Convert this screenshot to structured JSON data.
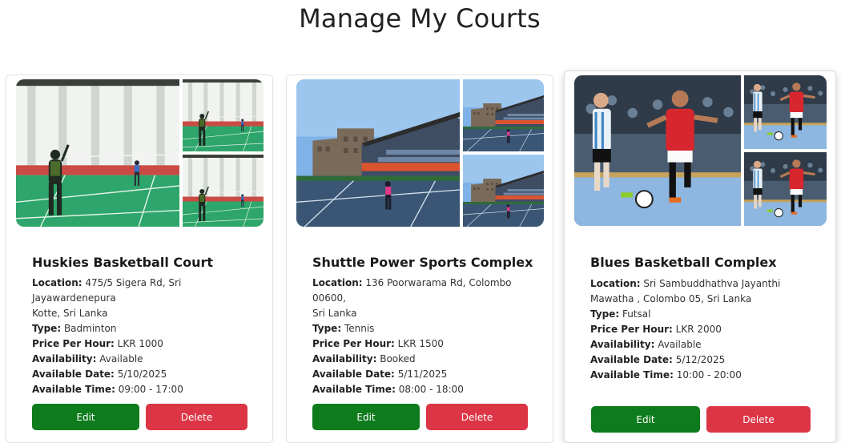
{
  "page": {
    "title": "Manage My Courts"
  },
  "labels": {
    "location": "Location:",
    "type": "Type:",
    "price": "Price Per Hour:",
    "availability": "Availability:",
    "date": "Available Date:",
    "time": "Available Time:"
  },
  "colors": {
    "edit": "#0e7b1c",
    "delete": "#dc3545"
  },
  "courts": [
    {
      "name": "Huskies Basketball Court",
      "location_line1": "475/5 Sigera Rd, Sri Jayawardenepura",
      "location_line2": "Kotte, Sri Lanka",
      "type": "Badminton",
      "price": "LKR 1000",
      "availability": "Available",
      "date": "5/10/2025",
      "time": "09:00 - 17:00",
      "edit_label": "Edit",
      "delete_label": "Delete"
    },
    {
      "name": "Shuttle Power Sports Complex",
      "location_line1": "136 Poorwarama Rd, Colombo 00600,",
      "location_line2": "Sri Lanka",
      "type": "Tennis",
      "price": "LKR 1500",
      "availability": "Booked",
      "date": "5/11/2025",
      "time": "08:00 - 18:00",
      "edit_label": "Edit",
      "delete_label": "Delete"
    },
    {
      "name": "Blues Basketball Complex",
      "location_line1": "Sri Sambuddhathva Jayanthi",
      "location_line2": "Mawatha , Colombo 05, Sri Lanka",
      "type": "Futsal",
      "price": "LKR 2000",
      "availability": "Available",
      "date": "5/12/2025",
      "time": "10:00 - 20:00",
      "edit_label": "Edit",
      "delete_label": "Delete"
    }
  ]
}
